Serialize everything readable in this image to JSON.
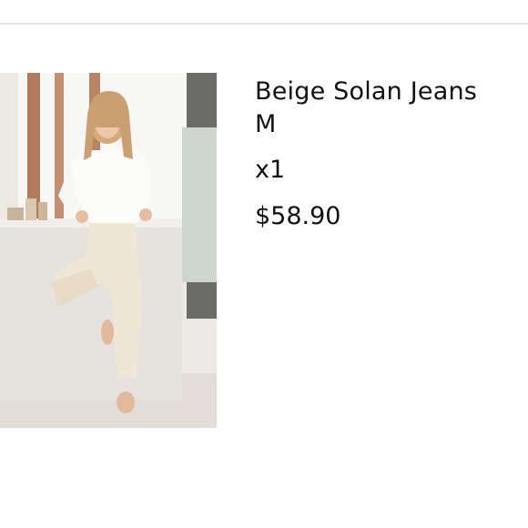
{
  "cart_item": {
    "image_alt": "Model wearing beige jeans and white top",
    "name": "Beige Solan Jeans",
    "size": "M",
    "quantity": "x1",
    "price": "$58.90"
  },
  "colors": {
    "text": "#111111",
    "divider": "#e4e4e4",
    "background": "#ffffff"
  }
}
